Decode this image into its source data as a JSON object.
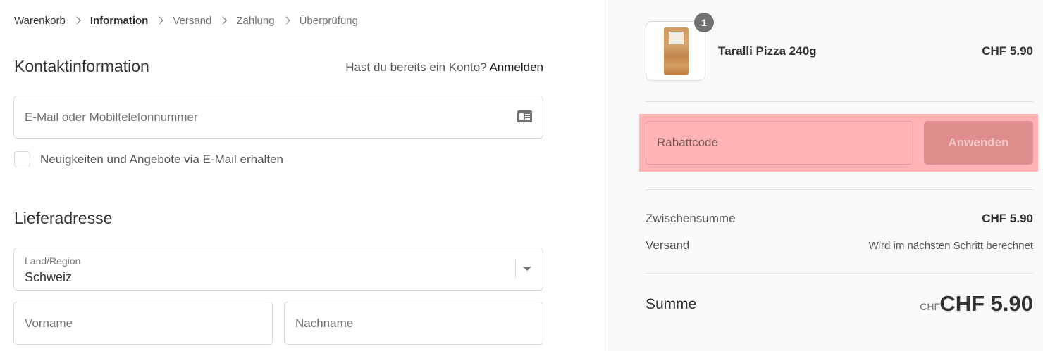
{
  "breadcrumb": {
    "items": [
      {
        "label": "Warenkorb",
        "state": "link"
      },
      {
        "label": "Information",
        "state": "current"
      },
      {
        "label": "Versand",
        "state": "inactive"
      },
      {
        "label": "Zahlung",
        "state": "inactive"
      },
      {
        "label": "Überprüfung",
        "state": "inactive"
      }
    ]
  },
  "contact": {
    "title": "Kontaktinformation",
    "account_prompt": "Hast du bereits ein Konto?",
    "login_link": "Anmelden",
    "email_placeholder": "E-Mail oder Mobiltelefonnummer",
    "email_icon": "id-card-icon",
    "newsletter_label": "Neuigkeiten und Angebote via E-Mail erhalten",
    "newsletter_checked": false
  },
  "shipping_address": {
    "title": "Lieferadresse",
    "country_label": "Land/Region",
    "country_value": "Schweiz",
    "first_name_placeholder": "Vorname",
    "last_name_placeholder": "Nachname"
  },
  "order_summary": {
    "product": {
      "name": "Taralli Pizza 240g",
      "price": "CHF 5.90",
      "quantity": "1"
    },
    "discount": {
      "placeholder": "Rabattcode",
      "apply_label": "Anwenden",
      "highlight_color": "#ffb3b3"
    },
    "subtotal_label": "Zwischensumme",
    "subtotal_value": "CHF 5.90",
    "shipping_label": "Versand",
    "shipping_value": "Wird im nächsten Schritt berechnet",
    "total_label": "Summe",
    "total_currency": "CHF",
    "total_value": "CHF 5.90"
  }
}
